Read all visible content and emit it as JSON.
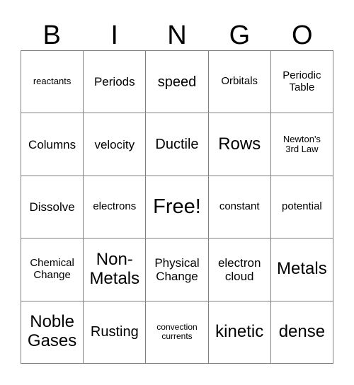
{
  "header": {
    "letters": [
      "B",
      "I",
      "N",
      "G",
      "O"
    ]
  },
  "grid": {
    "rows": [
      [
        {
          "text": "reactants",
          "size": "fs-s"
        },
        {
          "text": "Periods",
          "size": "fs-l"
        },
        {
          "text": "speed",
          "size": "fs-xl"
        },
        {
          "text": "Orbitals",
          "size": "fs-m"
        },
        {
          "text": "Periodic\nTable",
          "size": "fs-m"
        }
      ],
      [
        {
          "text": "Columns",
          "size": "fs-l"
        },
        {
          "text": "velocity",
          "size": "fs-l"
        },
        {
          "text": "Ductile",
          "size": "fs-xl"
        },
        {
          "text": "Rows",
          "size": "fs-xxl"
        },
        {
          "text": "Newton's\n3rd Law",
          "size": "fs-s"
        }
      ],
      [
        {
          "text": "Dissolve",
          "size": "fs-l"
        },
        {
          "text": "electrons",
          "size": "fs-m"
        },
        {
          "text": "Free!",
          "size": "fs-free"
        },
        {
          "text": "constant",
          "size": "fs-m"
        },
        {
          "text": "potential",
          "size": "fs-m"
        }
      ],
      [
        {
          "text": "Chemical\nChange",
          "size": "fs-m"
        },
        {
          "text": "Non-\nMetals",
          "size": "fs-xxl"
        },
        {
          "text": "Physical\nChange",
          "size": "fs-l"
        },
        {
          "text": "electron\ncloud",
          "size": "fs-l"
        },
        {
          "text": "Metals",
          "size": "fs-xxl"
        }
      ],
      [
        {
          "text": "Noble\nGases",
          "size": "fs-xxl"
        },
        {
          "text": "Rusting",
          "size": "fs-xl"
        },
        {
          "text": "convection\ncurrents",
          "size": "fs-xs"
        },
        {
          "text": "kinetic",
          "size": "fs-xxl"
        },
        {
          "text": "dense",
          "size": "fs-xxl"
        }
      ]
    ]
  },
  "colors": {
    "border": "#808080",
    "background": "#ffffff",
    "text": "#000000"
  }
}
